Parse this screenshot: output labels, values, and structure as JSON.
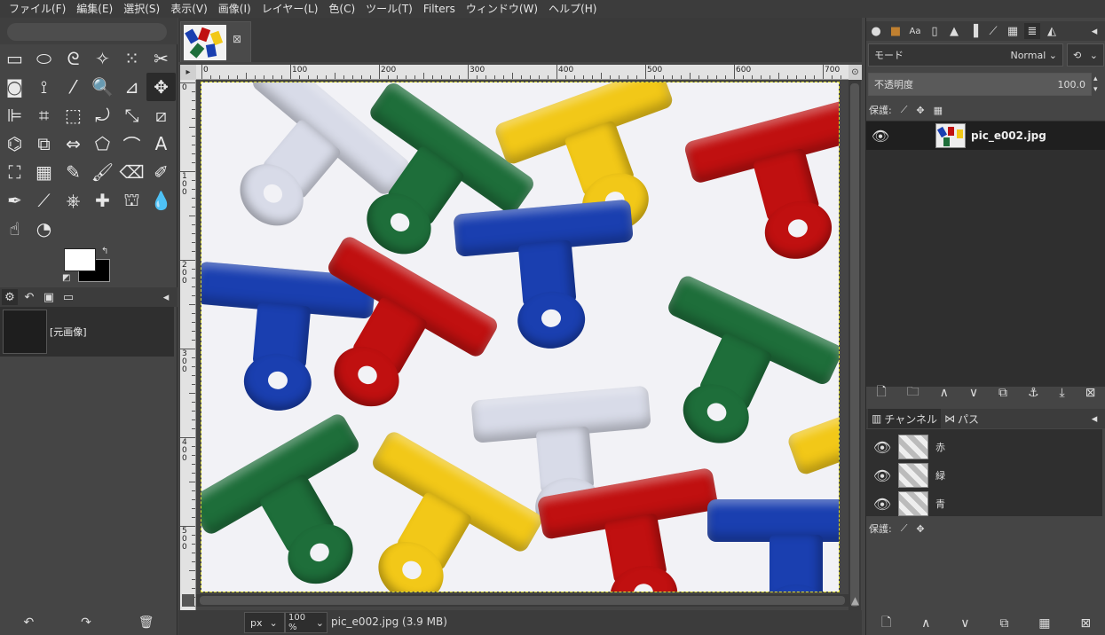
{
  "menu": [
    "ファイル(F)",
    "編集(E)",
    "選択(S)",
    "表示(V)",
    "画像(I)",
    "レイヤー(L)",
    "色(C)",
    "ツール(T)",
    "Filters",
    "ウィンドウ(W)",
    "ヘルプ(H)"
  ],
  "tools": [
    {
      "name": "rect-select-tool-icon",
      "glyph": "▭"
    },
    {
      "name": "ellipse-select-tool-icon",
      "glyph": "⬭"
    },
    {
      "name": "free-select-tool-icon",
      "glyph": "ᘓ"
    },
    {
      "name": "fuzzy-select-tool-icon",
      "glyph": "✧"
    },
    {
      "name": "color-select-tool-icon",
      "glyph": "⁙"
    },
    {
      "name": "scissors-tool-icon",
      "glyph": "✂"
    },
    {
      "name": "foreground-select-tool-icon",
      "glyph": "◙"
    },
    {
      "name": "paths-tool-icon",
      "glyph": "⟟"
    },
    {
      "name": "color-picker-tool-icon",
      "glyph": "⁄"
    },
    {
      "name": "zoom-tool-icon",
      "glyph": "🔍"
    },
    {
      "name": "measure-tool-icon",
      "glyph": "⊿"
    },
    {
      "name": "move-tool-icon",
      "glyph": "✥"
    },
    {
      "name": "align-tool-icon",
      "glyph": "⊫"
    },
    {
      "name": "crop-tool-icon",
      "glyph": "⌗"
    },
    {
      "name": "unified-transform-tool-icon",
      "glyph": "⬚"
    },
    {
      "name": "rotate-tool-icon",
      "glyph": "⤾"
    },
    {
      "name": "scale-tool-icon",
      "glyph": "⤡"
    },
    {
      "name": "shear-tool-icon",
      "glyph": "⧄"
    },
    {
      "name": "warp-transform-tool-icon",
      "glyph": "⌬"
    },
    {
      "name": "3d-transform-tool-icon",
      "glyph": "⧉"
    },
    {
      "name": "flip-tool-icon",
      "glyph": "⇔"
    },
    {
      "name": "cage-transform-tool-icon",
      "glyph": "⬠"
    },
    {
      "name": "smudge-warp-tool-icon",
      "glyph": "⌒"
    },
    {
      "name": "text-tool-icon",
      "glyph": "A"
    },
    {
      "name": "bucket-fill-tool-icon",
      "glyph": "⛶"
    },
    {
      "name": "gradient-tool-icon",
      "glyph": "▦"
    },
    {
      "name": "pencil-tool-icon",
      "glyph": "✎"
    },
    {
      "name": "paintbrush-tool-icon",
      "glyph": "🖌"
    },
    {
      "name": "eraser-tool-icon",
      "glyph": "⌫"
    },
    {
      "name": "airbrush-tool-icon",
      "glyph": "✐"
    },
    {
      "name": "ink-tool-icon",
      "glyph": "✒"
    },
    {
      "name": "mypaint-brush-tool-icon",
      "glyph": "⟋"
    },
    {
      "name": "clone-tool-icon",
      "glyph": "⎈"
    },
    {
      "name": "heal-tool-icon",
      "glyph": "✚"
    },
    {
      "name": "perspective-clone-tool-icon",
      "glyph": "⛫"
    },
    {
      "name": "blur-tool-icon",
      "glyph": "💧"
    },
    {
      "name": "smudge-tool-icon",
      "glyph": "☝"
    },
    {
      "name": "dodge-burn-tool-icon",
      "glyph": "◔"
    }
  ],
  "left_tabs": {
    "history_item": "[元画像]"
  },
  "image_tab": {
    "close": "⊠"
  },
  "ruler": {
    "h_labels": [
      "0",
      "100",
      "200",
      "300",
      "400",
      "500",
      "600",
      "700"
    ],
    "v_labels": [
      "0",
      "1\n0\n0",
      "2\n0\n0",
      "3\n0\n0",
      "4\n0\n0",
      "5\n0\n0"
    ]
  },
  "status": {
    "unit": "px",
    "zoom": "100 %",
    "info": "pic_e002.jpg (3.9 MB)"
  },
  "layers": {
    "mode_label": "モード",
    "mode_value": "Normal",
    "opacity_label": "不透明度",
    "opacity_value": "100.0",
    "lock_label": "保護:",
    "layer_name": "pic_e002.jpg"
  },
  "channels": {
    "tab_channels": "チャンネル",
    "tab_paths": "パス",
    "items": [
      "赤",
      "緑",
      "青"
    ],
    "lock_label": "保護:"
  },
  "colors": {
    "red": "#c01010",
    "green": "#1e6e3a",
    "blue": "#1a3fb0",
    "yellow": "#f2c818",
    "white_clip": "#d8dbe8"
  }
}
